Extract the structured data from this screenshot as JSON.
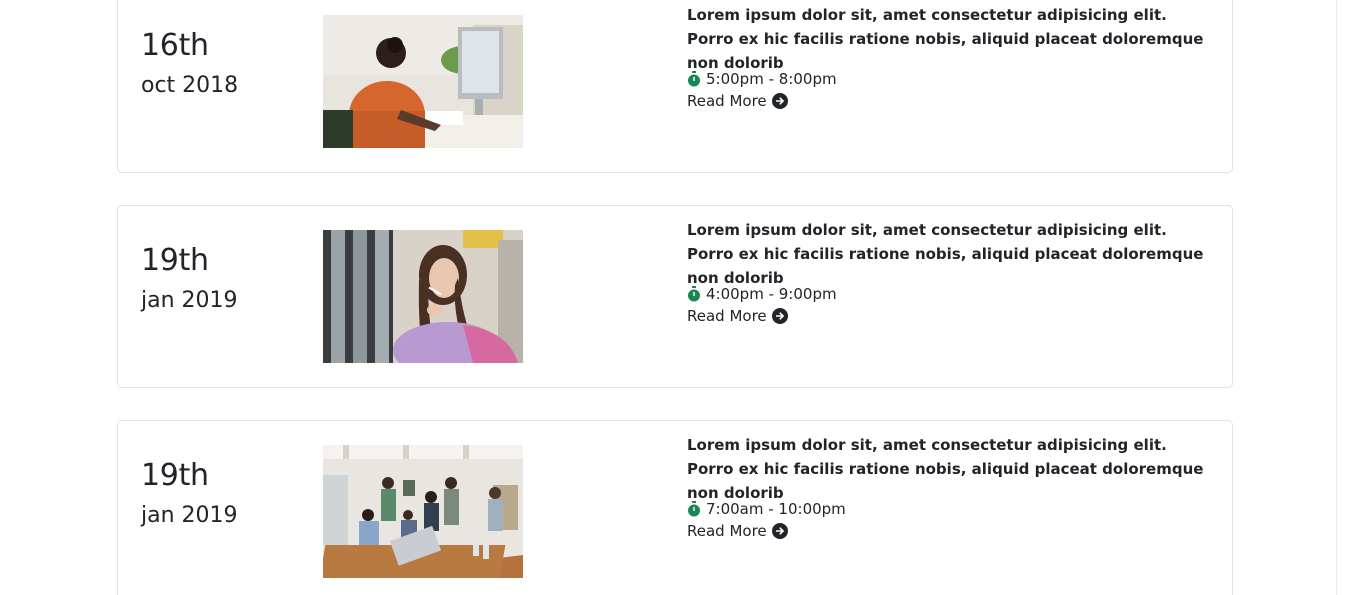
{
  "events": [
    {
      "day": "16th",
      "month_year": "oct 2018",
      "title": "Lorem ipsum dolor sit, amet consectetur adipisicing elit. Porro ex hic facilis ratione nobis, aliquid placeat doloremque non dolorib",
      "time": "5:00pm - 8:00pm",
      "read_more": "Read More",
      "photo_alt": "woman working at desktop computer"
    },
    {
      "day": "19th",
      "month_year": "jan 2019",
      "title": "Lorem ipsum dolor sit, amet consectetur adipisicing elit. Porro ex hic facilis ratione nobis, aliquid placeat doloremque non dolorib",
      "time": "4:00pm - 9:00pm",
      "read_more": "Read More",
      "photo_alt": "woman thinking with pen"
    },
    {
      "day": "19th",
      "month_year": "jan 2019",
      "title": "Lorem ipsum dolor sit, amet consectetur adipisicing elit. Porro ex hic facilis ratione nobis, aliquid placeat doloremque non dolorib",
      "time": "7:00am - 10:00pm",
      "read_more": "Read More",
      "photo_alt": "team meeting around laptop"
    }
  ],
  "colors": {
    "accent_green": "#198754",
    "text": "#212529",
    "border": "#dee2e6"
  },
  "icons": {
    "time": "stopwatch-icon",
    "read_more": "arrow-circle-right-icon"
  }
}
